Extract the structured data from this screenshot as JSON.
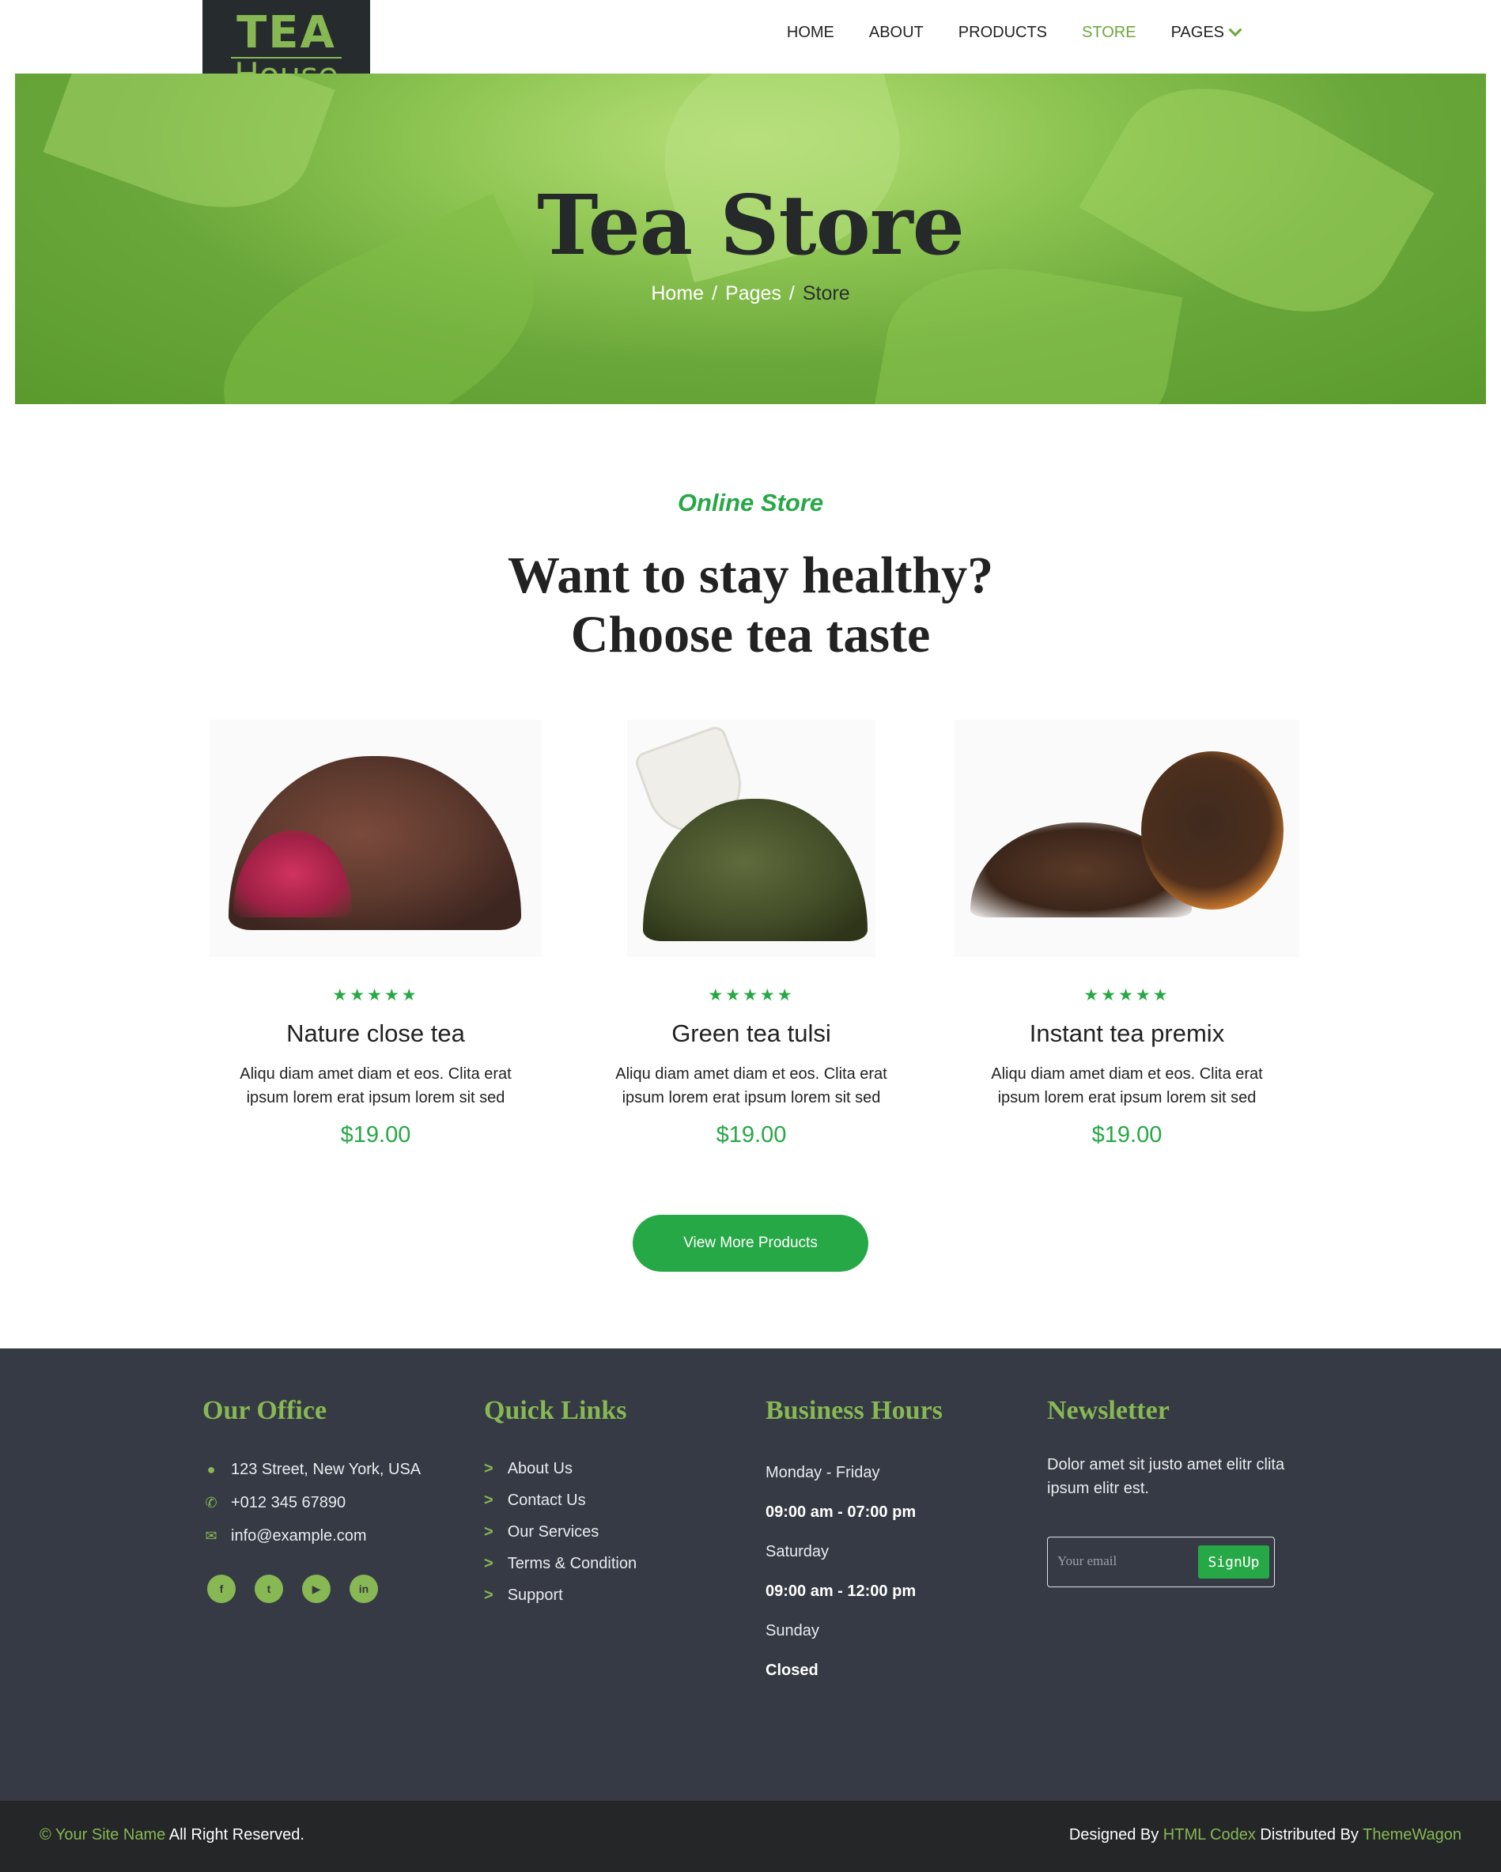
{
  "brand": {
    "logo_top": "TEA",
    "logo_bottom": "House"
  },
  "nav": {
    "items": [
      {
        "label": "HOME"
      },
      {
        "label": "ABOUT"
      },
      {
        "label": "PRODUCTS"
      },
      {
        "label": "STORE"
      },
      {
        "label": "PAGES"
      }
    ],
    "active": "STORE"
  },
  "hero": {
    "title": "Tea Store",
    "breadcrumb": [
      "Home",
      "Pages",
      "Store"
    ],
    "separator": "/"
  },
  "store": {
    "subtitle": "Online Store",
    "heading_line1": "Want to stay healthy?",
    "heading_line2": "Choose tea taste",
    "products": [
      {
        "name": "Nature close tea",
        "stars": "★★★★★",
        "desc": "Aliqu diam amet diam et eos. Clita erat ipsum lorem erat ipsum lorem sit sed",
        "price": "$19.00"
      },
      {
        "name": "Green tea tulsi",
        "stars": "★★★★★",
        "desc": "Aliqu diam amet diam et eos. Clita erat ipsum lorem erat ipsum lorem sit sed",
        "price": "$19.00"
      },
      {
        "name": "Instant tea premix",
        "stars": "★★★★★",
        "desc": "Aliqu diam amet diam et eos. Clita erat ipsum lorem erat ipsum lorem sit sed",
        "price": "$19.00"
      }
    ],
    "more_button": "View More Products"
  },
  "footer": {
    "office": {
      "title": "Our Office",
      "address": "123 Street, New York, USA",
      "phone": "+012 345 67890",
      "email": "info@example.com",
      "socials": [
        "facebook-icon",
        "twitter-icon",
        "youtube-icon",
        "linkedin-icon"
      ]
    },
    "links": {
      "title": "Quick Links",
      "items": [
        "About Us",
        "Contact Us",
        "Our Services",
        "Terms & Condition",
        "Support"
      ]
    },
    "hours": {
      "title": "Business Hours",
      "rows": [
        {
          "label": "Monday - Friday",
          "time": "09:00 am - 07:00 pm"
        },
        {
          "label": "Saturday",
          "time": "09:00 am - 12:00 pm"
        },
        {
          "label": "Sunday",
          "time": "Closed"
        }
      ]
    },
    "newsletter": {
      "title": "Newsletter",
      "text": "Dolor amet sit justo amet elitr clita ipsum elitr est.",
      "placeholder": "Your email",
      "button": "SignUp"
    }
  },
  "copyright": {
    "site_name": "© Your Site Name",
    "rights": " All Right Reserved.",
    "designed_by": "Designed By ",
    "designer": "HTML Codex",
    "distributed_by": " Distributed By ",
    "distributor": "ThemeWagon"
  },
  "colors": {
    "accent": "#27a846",
    "brand_green": "#87b853",
    "footer_bg": "#353a44",
    "logo_bg": "#262b2d"
  }
}
